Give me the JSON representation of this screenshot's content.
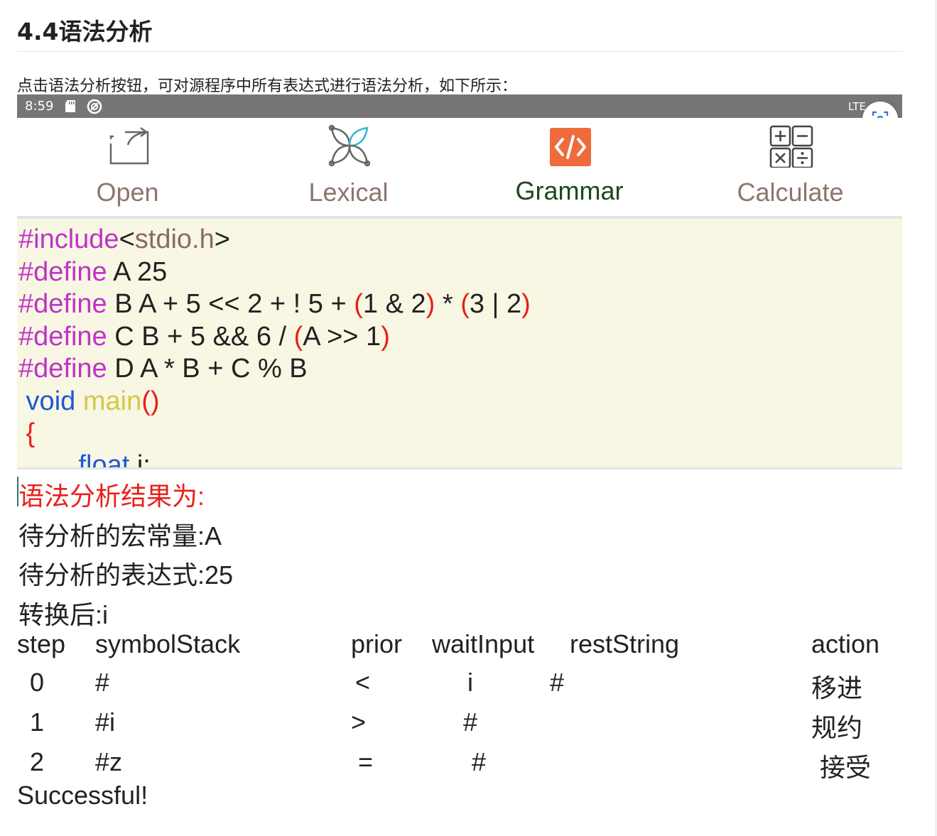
{
  "doc": {
    "title": "4.4语法分析",
    "paragraph": "点击语法分析按钮，可对源程序中所有表达式进行语法分析，如下所示："
  },
  "status_bar": {
    "time": "8:59",
    "network": "LTE"
  },
  "toolbar": {
    "items": [
      {
        "label": "Open",
        "icon": "open-icon"
      },
      {
        "label": "Lexical",
        "icon": "lexical-icon"
      },
      {
        "label": "Grammar",
        "icon": "code-icon",
        "active": true
      },
      {
        "label": "Calculate",
        "icon": "calculator-icon"
      }
    ],
    "active_color": "#1b4a17",
    "inactive_color": "#8d756e",
    "grammar_icon_bg": "#ef6b3c"
  },
  "editor": {
    "background": "#f8f7e4",
    "lines": [
      {
        "p1": "#include",
        "p2": "<",
        "p3": "stdio.h",
        "p4": ">"
      },
      {
        "p1": "#define",
        "p2": " A 25"
      },
      {
        "p1": "#define",
        "p2": " B A + 5 << 2 + ! 5 + ",
        "p3": "(",
        "p4": "1 & 2",
        "p5": ")",
        "p6": " * ",
        "p7": "(",
        "p8": "3 | 2",
        "p9": ")"
      },
      {
        "p1": "#define",
        "p2": " C B + 5 && 6 / ",
        "p3": "(",
        "p4": "A >> 1",
        "p5": ")"
      },
      {
        "p1": "#define",
        "p2": " D A * B + C % B"
      },
      {
        "p1": " void",
        "p2": " main",
        "p3": "()"
      },
      {
        "p1": " {"
      },
      {
        "p1": "        float",
        "p2": " i;"
      }
    ]
  },
  "result": {
    "title": "语法分析结果为:",
    "macro": "待分析的宏常量:A",
    "expression": "待分析的表达式:25",
    "converted": "转换后:i",
    "headers": {
      "step": "step",
      "symbol_stack": "symbolStack",
      "prior": "prior",
      "wait_input": "waitInput",
      "rest_string": "restString",
      "action": "action"
    },
    "rows": [
      {
        "step": "0",
        "symbol_stack": "#",
        "prior": "<",
        "wait_input": "i",
        "rest_string": "#",
        "action": "移进"
      },
      {
        "step": "1",
        "symbol_stack": "#i",
        "prior": ">",
        "wait_input": "#",
        "rest_string": "",
        "action": "规约"
      },
      {
        "step": "2",
        "symbol_stack": "#z",
        "prior": "=",
        "wait_input": "#",
        "rest_string": "",
        "action": "接受"
      }
    ],
    "footer": "Successful!"
  }
}
